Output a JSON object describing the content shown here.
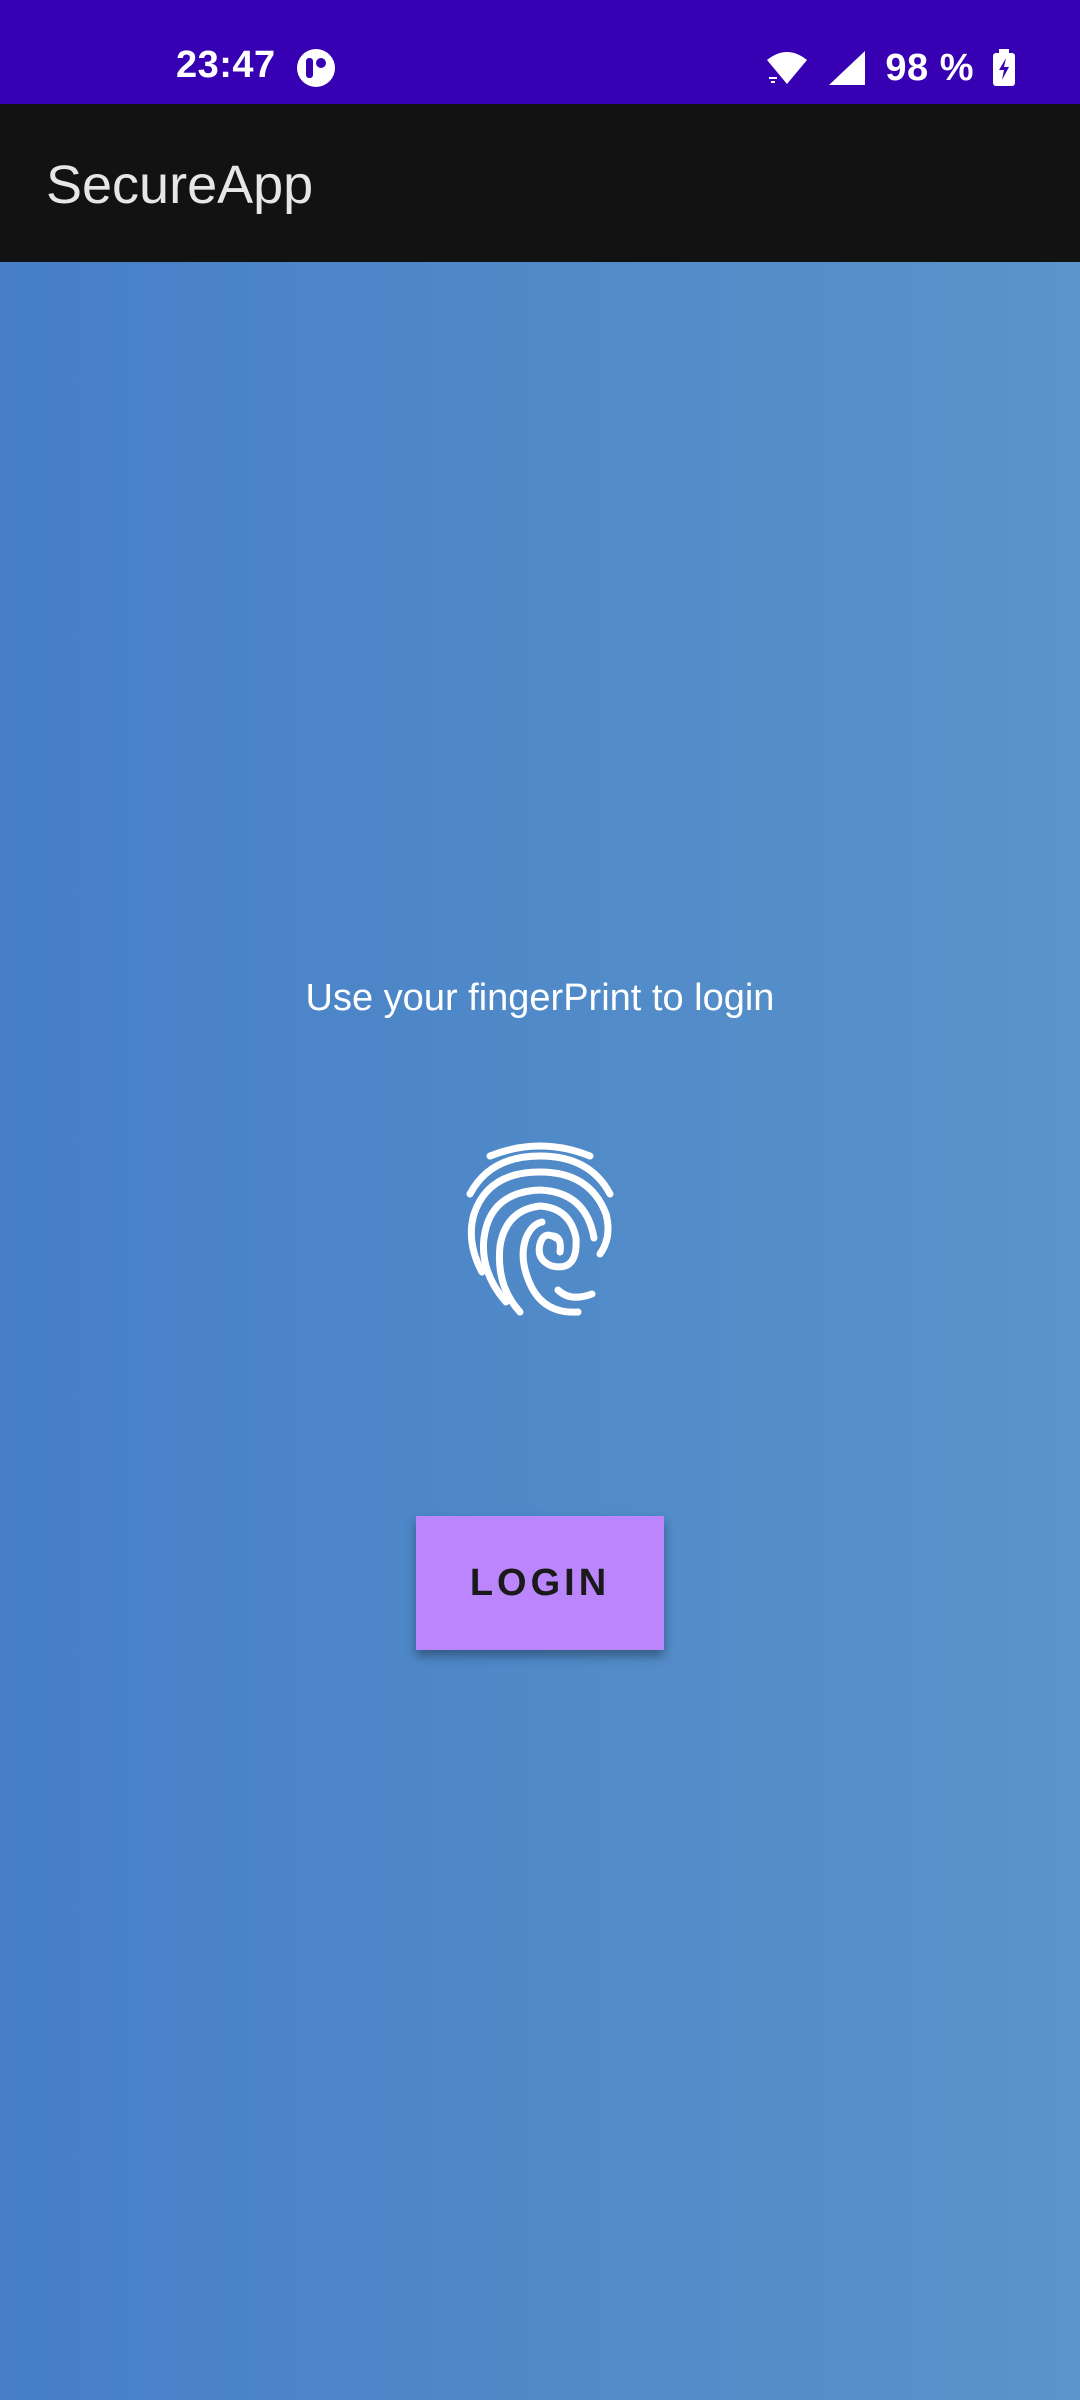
{
  "status_bar": {
    "time": "23:47",
    "battery": "98 %",
    "app_icon": "notification-app-icon",
    "wifi_icon": "wifi-icon",
    "signal_icon": "signal-icon",
    "battery_icon": "battery-charging-icon",
    "background_color": "#3700b3"
  },
  "app_bar": {
    "title": "SecureApp",
    "background_color": "#121212"
  },
  "main": {
    "prompt": "Use your fingerPrint to login",
    "fingerprint_icon": "fingerprint-icon",
    "login_label": "LOGIN",
    "button_color": "#bb86fc",
    "gradient_start": "#467fc8",
    "gradient_end": "#5a94c9"
  }
}
